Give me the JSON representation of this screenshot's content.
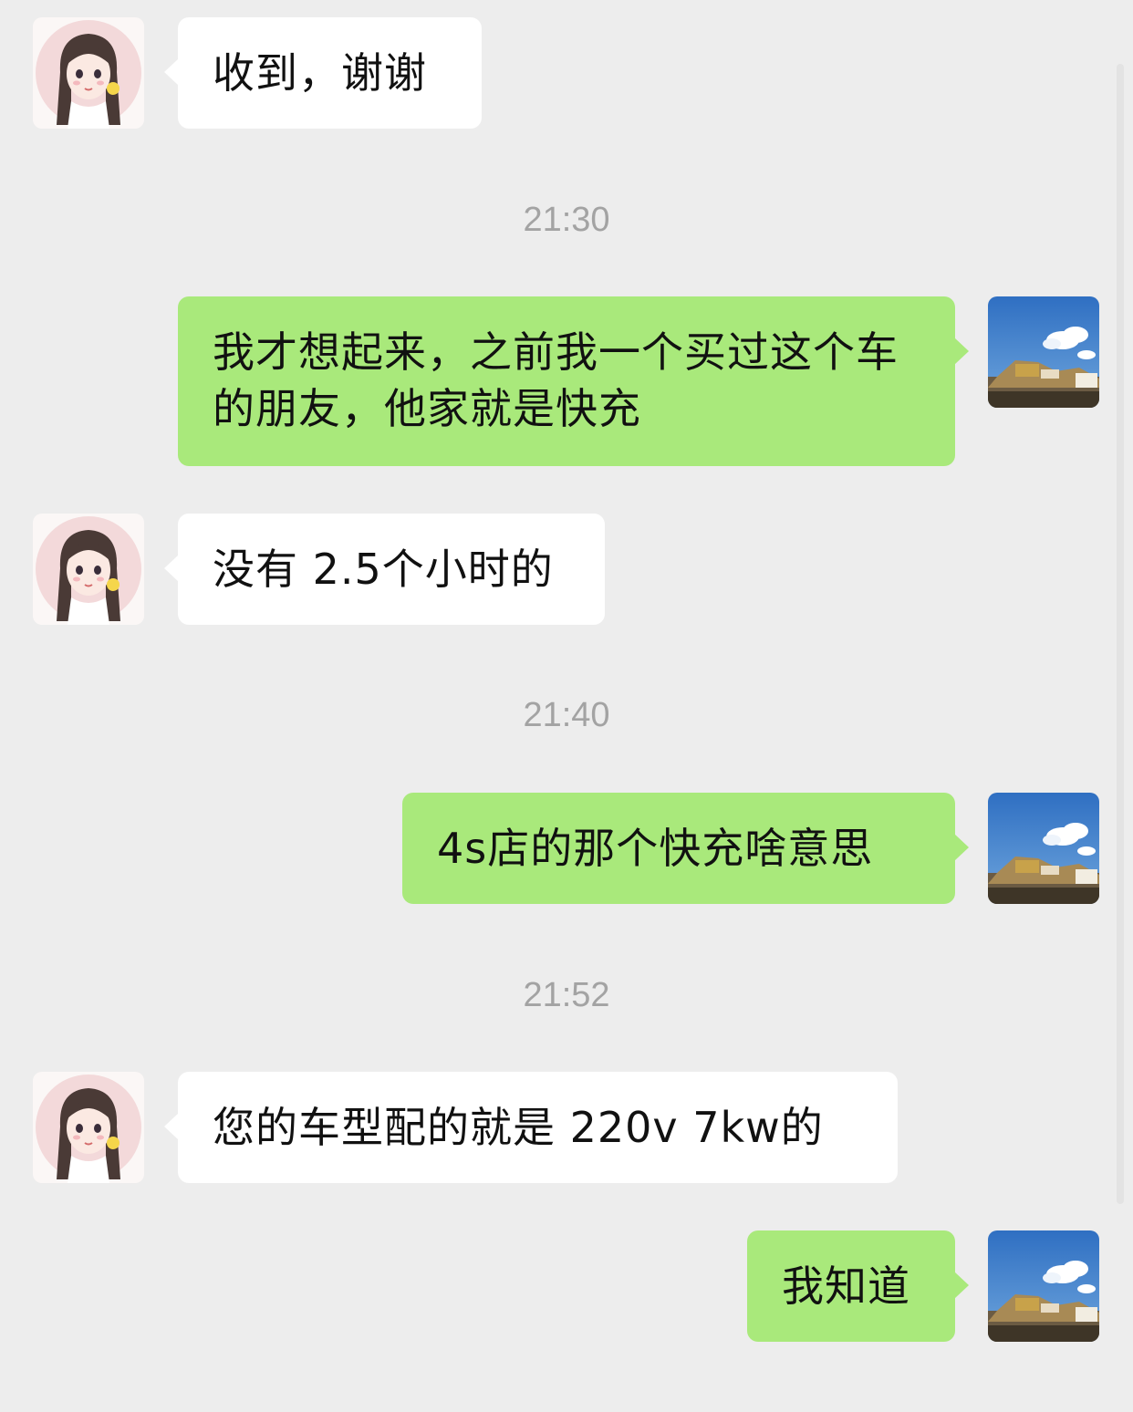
{
  "messages": [
    {
      "from": "contact",
      "text": "收到，谢谢",
      "avatar": "girl-avatar-icon"
    },
    {
      "time": "21:30"
    },
    {
      "from": "me",
      "text": "我才想起来，之前我一个买过这个车的朋友，他家就是快充",
      "avatar": "landscape-avatar-icon"
    },
    {
      "from": "contact",
      "text": "没有 2.5个小时的",
      "avatar": "girl-avatar-icon"
    },
    {
      "time": "21:40"
    },
    {
      "from": "me",
      "text": "4s店的那个快充啥意思",
      "avatar": "landscape-avatar-icon"
    },
    {
      "time": "21:52"
    },
    {
      "from": "contact",
      "text": "您的车型配的就是 220v  7kw的",
      "avatar": "girl-avatar-icon"
    },
    {
      "from": "me",
      "text": "我知道",
      "avatar": "landscape-avatar-icon"
    }
  ],
  "colors": {
    "background": "#ededed",
    "incoming_bubble": "#ffffff",
    "outgoing_bubble": "#a9e97b",
    "timestamp": "#a3a3a3"
  }
}
